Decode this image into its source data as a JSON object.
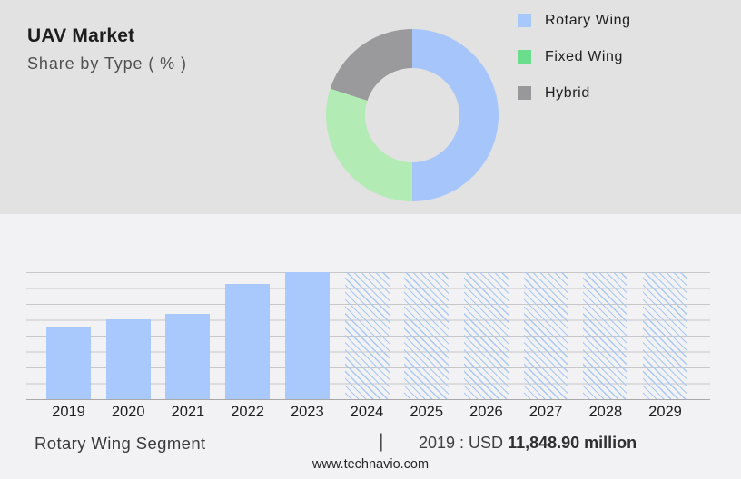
{
  "header": {
    "title": "UAV Market",
    "subtitle": "Share by Type ( % )"
  },
  "donut": {
    "type": "donut",
    "title": "Share by Type ( % )",
    "segments": [
      {
        "label": "Rotary Wing",
        "share_pct": 50,
        "color": "#a6c5fa",
        "legend_color": "#a6c8fa"
      },
      {
        "label": "Fixed Wing",
        "share_pct": 30,
        "color": "#b2ecb4",
        "legend_color": "#6ade8c"
      },
      {
        "label": "Hybrid",
        "share_pct": 20,
        "color": "#9a9a9c",
        "legend_color": "#98989a"
      }
    ],
    "legend_position": "right"
  },
  "chart_data": {
    "type": "bar",
    "title": "Rotary Wing Segment",
    "xlabel": "",
    "ylabel": "",
    "y_axis_labels_shown": false,
    "grid": true,
    "categories": [
      "2019",
      "2020",
      "2021",
      "2022",
      "2023",
      "2024",
      "2025",
      "2026",
      "2027",
      "2028",
      "2029"
    ],
    "series": [
      {
        "name": "Rotary Wing",
        "values_pct_of_max": [
          57,
          63,
          67,
          91,
          100,
          100,
          100,
          100,
          100,
          100,
          100
        ]
      }
    ],
    "bar_styles": [
      "solid",
      "solid",
      "solid",
      "solid",
      "solid",
      "hatched",
      "hatched",
      "hatched",
      "hatched",
      "hatched",
      "hatched"
    ],
    "known_values": [
      {
        "year": "2019",
        "value": "USD 11,848.90 million"
      }
    ]
  },
  "footer": {
    "segment_label": "Rotary Wing Segment",
    "divider": "|",
    "value_prefix": "2019 : USD",
    "value_bold": "11,848.90 million",
    "website": "www.technavio.com"
  },
  "colors": {
    "panel_top": "#e2e2e2",
    "panel_bottom": "#f2f2f4",
    "bar_solid": "#a9c8fb",
    "bar_hatch": "#a9c8f8",
    "gridline": "#c7c7c9",
    "axis": "#a8a8aa"
  }
}
